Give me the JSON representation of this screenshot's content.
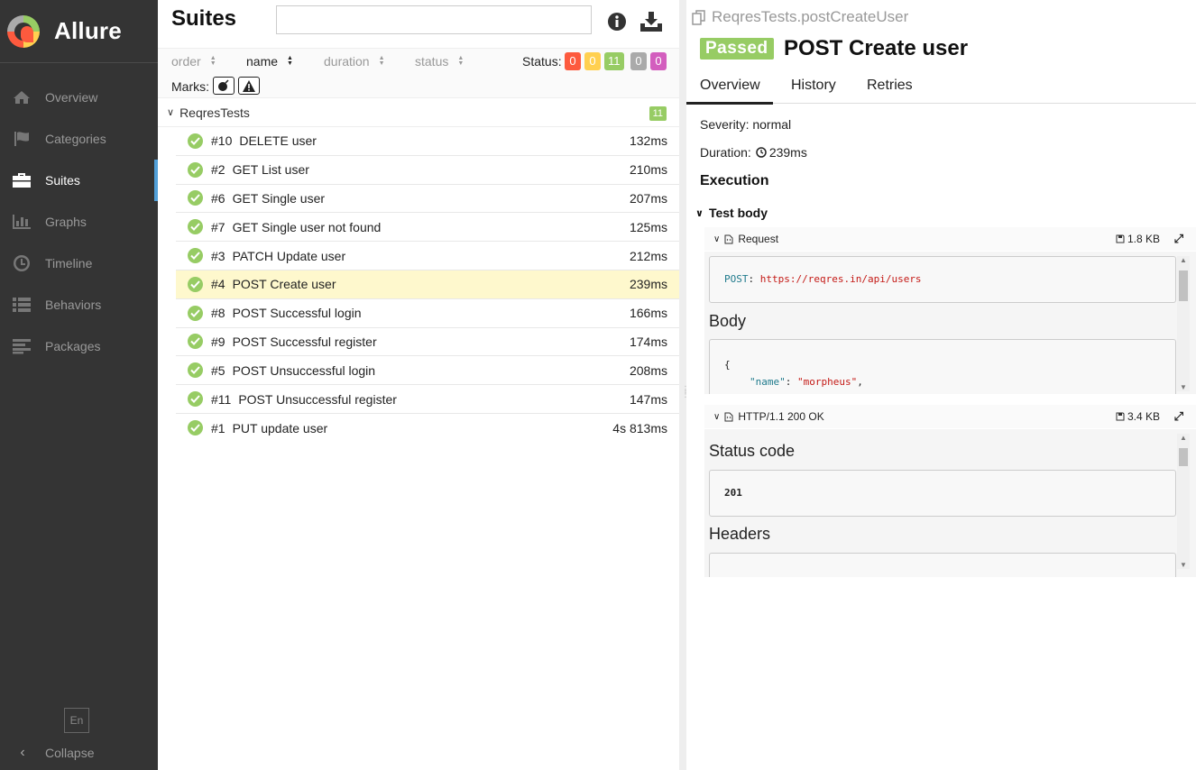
{
  "sidebar": {
    "brand": "Allure",
    "items": [
      {
        "label": "Overview",
        "icon": "home-icon"
      },
      {
        "label": "Categories",
        "icon": "flag-icon"
      },
      {
        "label": "Suites",
        "icon": "briefcase-icon"
      },
      {
        "label": "Graphs",
        "icon": "bar-chart-icon"
      },
      {
        "label": "Timeline",
        "icon": "clock-icon"
      },
      {
        "label": "Behaviors",
        "icon": "list-icon"
      },
      {
        "label": "Packages",
        "icon": "align-left-icon"
      }
    ],
    "active": "Suites",
    "lang": "En",
    "collapse": "Collapse"
  },
  "suites": {
    "title": "Suites",
    "search_placeholder": "",
    "sort": {
      "order": "order",
      "name": "name",
      "duration": "duration",
      "status": "status"
    },
    "status_label": "Status:",
    "status_counts": [
      {
        "value": "0",
        "color": "#fd5a3e"
      },
      {
        "value": "0",
        "color": "#ffd050"
      },
      {
        "value": "11",
        "color": "#97cc64"
      },
      {
        "value": "0",
        "color": "#aaaaaa"
      },
      {
        "value": "0",
        "color": "#d35ebe"
      }
    ],
    "marks_label": "Marks:",
    "group": {
      "name": "ReqresTests",
      "count": "11"
    },
    "tests": [
      {
        "num": "#10",
        "name": "DELETE user",
        "duration": "132ms"
      },
      {
        "num": "#2",
        "name": "GET List user",
        "duration": "210ms"
      },
      {
        "num": "#6",
        "name": "GET Single user",
        "duration": "207ms"
      },
      {
        "num": "#7",
        "name": "GET Single user not found",
        "duration": "125ms"
      },
      {
        "num": "#3",
        "name": "PATCH Update user",
        "duration": "212ms"
      },
      {
        "num": "#4",
        "name": "POST Create user",
        "duration": "239ms"
      },
      {
        "num": "#8",
        "name": "POST Successful login",
        "duration": "166ms"
      },
      {
        "num": "#9",
        "name": "POST Successful register",
        "duration": "174ms"
      },
      {
        "num": "#5",
        "name": "POST Unsuccessful login",
        "duration": "208ms"
      },
      {
        "num": "#11",
        "name": "POST Unsuccessful register",
        "duration": "147ms"
      },
      {
        "num": "#1",
        "name": "PUT update user",
        "duration": "4s 813ms"
      }
    ],
    "selected": "#4"
  },
  "detail": {
    "breadcrumb": "ReqresTests.postCreateUser",
    "status": "Passed",
    "title": "POST Create user",
    "tabs": [
      "Overview",
      "History",
      "Retries"
    ],
    "severity": "Severity: normal",
    "duration_label": "Duration:",
    "duration": "239ms",
    "execution": "Execution",
    "test_body": "Test body",
    "request": {
      "label": "Request",
      "size": "1.8 KB",
      "method": "POST",
      "url": "https://reqres.in/api/users",
      "body_title": "Body",
      "body_open": "{",
      "body_key": "\"name\"",
      "body_val": "\"morpheus\""
    },
    "response": {
      "label": "HTTP/1.1 200 OK",
      "size": "3.4 KB",
      "status_title": "Status code",
      "status_code": "201",
      "headers_title": "Headers"
    }
  },
  "colors": {
    "passed": "#97cc64",
    "sidebar": "#343434",
    "selected_row": "#fef8cd",
    "active_bar": "#52a0d9"
  }
}
